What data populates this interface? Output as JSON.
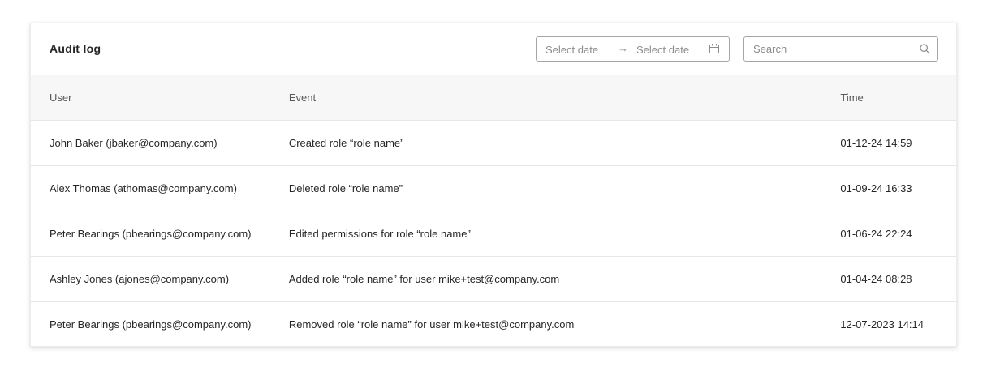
{
  "header": {
    "title": "Audit log",
    "date_start_placeholder": "Select date",
    "date_arrow": "→",
    "date_end_placeholder": "Select date",
    "search_placeholder": "Search"
  },
  "table": {
    "columns": [
      "User",
      "Event",
      "Time"
    ],
    "rows": [
      {
        "user": "John Baker (jbaker@company.com)",
        "event": "Created role “role name”",
        "time": "01-12-24 14:59"
      },
      {
        "user": "Alex Thomas (athomas@company.com)",
        "event": "Deleted role “role name”",
        "time": "01-09-24 16:33"
      },
      {
        "user": "Peter Bearings (pbearings@company.com)",
        "event": "Edited permissions for role “role name”",
        "time": "01-06-24 22:24"
      },
      {
        "user": "Ashley Jones (ajones@company.com)",
        "event": "Added role “role name” for user mike+test@company.com",
        "time": "01-04-24 08:28"
      },
      {
        "user": "Peter Bearings (pbearings@company.com)",
        "event": "Removed role “role name” for user mike+test@company.com",
        "time": "12-07-2023 14:14"
      }
    ]
  },
  "icons": {
    "calendar": "calendar-icon",
    "search": "search-icon"
  },
  "colors": {
    "header_bg": "#f7f7f7",
    "border": "#e6e6e6",
    "input_border": "#a6a6a6",
    "placeholder": "#8c8c8c"
  }
}
